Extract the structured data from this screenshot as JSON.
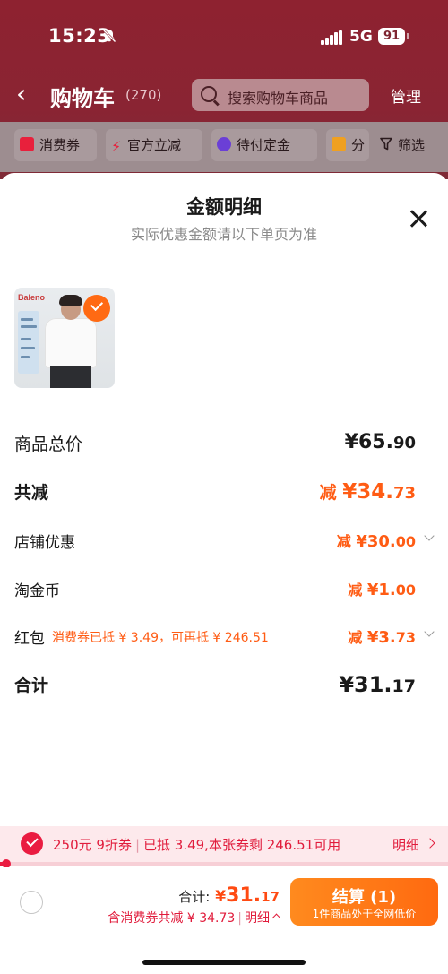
{
  "status_bar": {
    "time": "15:23",
    "network": "5G",
    "battery": "91"
  },
  "header": {
    "title": "购物车",
    "count": "(270)",
    "search_placeholder": "搜索购物车商品",
    "manage": "管理"
  },
  "filters": [
    {
      "label": "消费券",
      "icon": "coupon-icon",
      "color": "#e8203c"
    },
    {
      "label": "官方立减",
      "icon": "lightning-icon",
      "color": "#e8203c"
    },
    {
      "label": "待付定金",
      "icon": "clock-icon",
      "color": "#6b3fd6"
    },
    {
      "label": "分",
      "icon": "folder-icon",
      "color": "#f0a020"
    },
    {
      "label": "筛选",
      "icon": "funnel-icon"
    }
  ],
  "sheet": {
    "title": "金额明细",
    "subtitle": "实际优惠金额请以下单页为准",
    "product_brand": "Baleno",
    "rows": {
      "total_label": "商品总价",
      "total_int": "¥65.",
      "total_dec": "90",
      "minus_label": "共减",
      "minus_prefix": "减 ",
      "minus_int": "¥34.",
      "minus_dec": "73",
      "shop_label": "店铺优惠",
      "shop_prefix": "减 ",
      "shop_int": "¥30.",
      "shop_dec": "00",
      "coin_label": "淘金币",
      "coin_prefix": "减 ",
      "coin_int": "¥1.",
      "coin_dec": "00",
      "hb_label": "红包",
      "hb_note": "消费券已抵 ¥ 3.49，可再抵 ¥ 246.51",
      "hb_prefix": "减 ",
      "hb_int": "¥3.",
      "hb_dec": "73",
      "sum_label": "合计",
      "sum_int": "¥31.",
      "sum_dec": "17"
    }
  },
  "coupon_bar": {
    "name": "250元 9折券",
    "info": "已抵 3.49,本张券剩 246.51可用",
    "detail": "明细",
    "progress": 0.014
  },
  "checkout": {
    "sum_label": "合计:",
    "sum_currency": "¥",
    "sum_int": "31.",
    "sum_dec": "17",
    "discount_text": "含消费券共减 ¥ 34.73",
    "detail": "明细",
    "pay_label": "结算 (1)",
    "pay_sub": "1件商品处于全网低价",
    "accent": "#ff6a10"
  }
}
